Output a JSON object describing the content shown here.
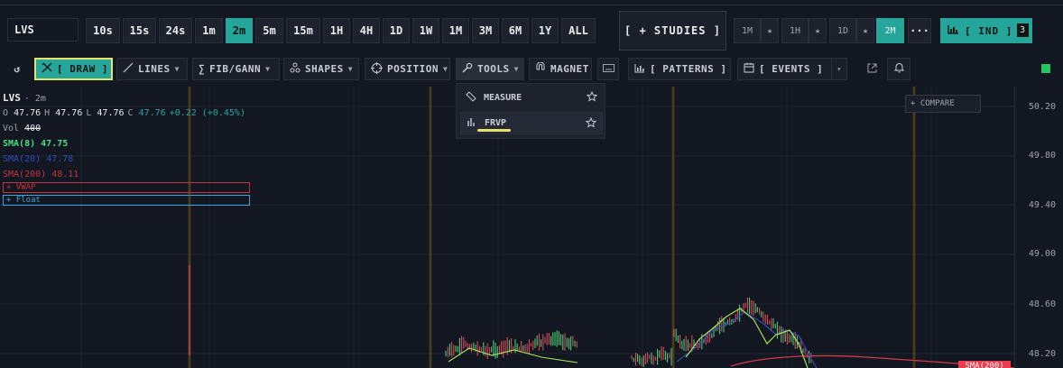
{
  "symbol": {
    "value": "LVS"
  },
  "timeframes": [
    {
      "label": "10s",
      "active": false
    },
    {
      "label": "15s",
      "active": false
    },
    {
      "label": "24s",
      "active": false
    },
    {
      "label": "1m",
      "active": false
    },
    {
      "label": "2m",
      "active": true
    },
    {
      "label": "5m",
      "active": false
    },
    {
      "label": "15m",
      "active": false
    },
    {
      "label": "1H",
      "active": false
    },
    {
      "label": "4H",
      "active": false
    },
    {
      "label": "1D",
      "active": false
    },
    {
      "label": "1W",
      "active": false
    },
    {
      "label": "1M",
      "active": false
    },
    {
      "label": "3M",
      "active": false
    },
    {
      "label": "6M",
      "active": false
    },
    {
      "label": "1Y",
      "active": false
    },
    {
      "label": "ALL",
      "active": false
    }
  ],
  "studies_label": "[ + STUDIES ]",
  "favorites": [
    {
      "label": "1M",
      "active": false
    },
    {
      "label": "1H",
      "active": false
    },
    {
      "label": "1D",
      "active": false
    },
    {
      "label": "2M",
      "active": true
    }
  ],
  "more_label": "···",
  "ind": {
    "label": "[ IND ]",
    "count": "3"
  },
  "toolbar": {
    "draw": "[ DRAW ]",
    "lines": "LINES",
    "fib": "FIB/GANN",
    "shapes": "SHAPES",
    "position": "POSITION",
    "tools": "TOOLS",
    "magnet": "MAGNET",
    "patterns": "[ PATTERNS ]",
    "events": "[ EVENTS ]"
  },
  "legend": {
    "symbol": "LVS",
    "interval": "· 2m",
    "ohlc": {
      "o_k": "O",
      "o": "47.76",
      "h_k": "H",
      "h": "47.76",
      "l_k": "L",
      "l": "47.76",
      "c_k": "C",
      "c": "47.76",
      "change": "+0.22 (+0.45%)"
    },
    "vol_k": "Vol",
    "vol": "400",
    "sma8": {
      "label": "SMA(8)",
      "value": "47.75",
      "color": "#4ade80"
    },
    "sma20": {
      "label": "SMA(20)",
      "value": "47.78",
      "color": "#2f4eb8"
    },
    "sma200": {
      "label": "SMA(200)",
      "value": "48.11",
      "color": "#c0353f"
    },
    "vwap": {
      "label": "+ VWAP",
      "color": "#c0353f"
    },
    "float": {
      "label": "+ Float",
      "color": "#3aa6d8"
    }
  },
  "compare_label": "+ COMPARE",
  "tools_menu": [
    {
      "label": "MEASURE",
      "icon": "ruler-icon"
    },
    {
      "label": "FRVP",
      "icon": "volume-profile-icon"
    }
  ],
  "price_axis": {
    "ticks": [
      "50.20",
      "49.80",
      "49.40",
      "49.00",
      "48.60",
      "48.20"
    ],
    "sma_tag": "SMA(200)"
  },
  "colors": {
    "accent": "#26a69a",
    "highlight": "#e4e36b",
    "background": "#131722",
    "sma200_tag": "#ef3b4d"
  }
}
